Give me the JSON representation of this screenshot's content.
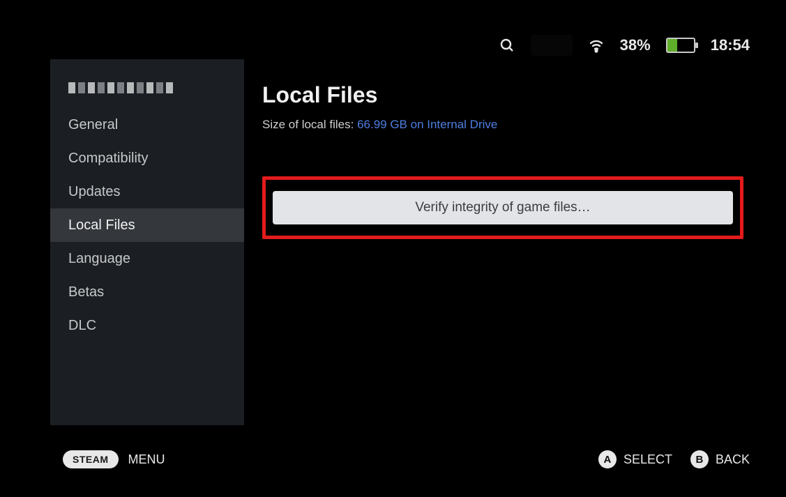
{
  "status": {
    "battery_pct": "38%",
    "battery_fill_pct": 38,
    "time": "18:54"
  },
  "sidebar": {
    "items": [
      {
        "label": "General"
      },
      {
        "label": "Compatibility"
      },
      {
        "label": "Updates"
      },
      {
        "label": "Local Files",
        "active": true
      },
      {
        "label": "Language"
      },
      {
        "label": "Betas"
      },
      {
        "label": "DLC"
      }
    ]
  },
  "main": {
    "title": "Local Files",
    "size_label": "Size of local files: ",
    "size_value": "66.99 GB on Internal Drive",
    "verify_btn_label": "Verify integrity of game files…"
  },
  "footer": {
    "steam_label": "STEAM",
    "menu_label": "MENU",
    "select_glyph": "A",
    "select_label": "SELECT",
    "back_glyph": "B",
    "back_label": "BACK"
  }
}
